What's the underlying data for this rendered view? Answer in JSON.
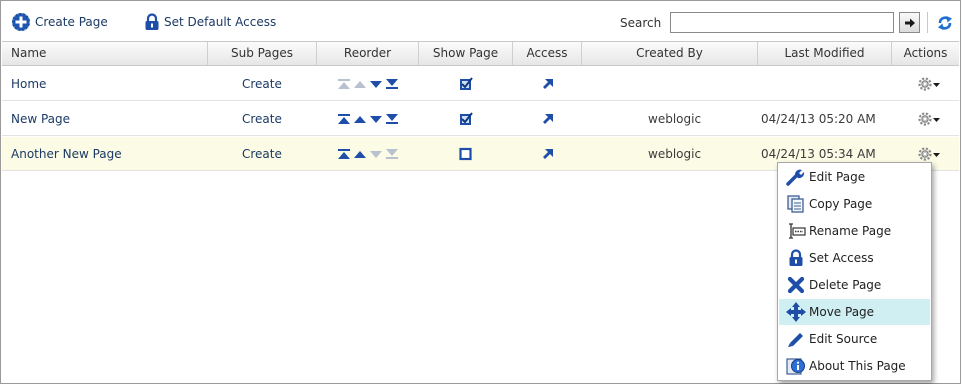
{
  "toolbar": {
    "create_page": "Create Page",
    "set_default_access": "Set Default Access",
    "search_label": "Search",
    "search_value": ""
  },
  "columns": [
    "Name",
    "Sub Pages",
    "Reorder",
    "Show Page",
    "Access",
    "Created By",
    "Last Modified",
    "Actions"
  ],
  "rows": [
    {
      "name": "Home",
      "sub_pages": "Create",
      "show_page": true,
      "created_by": "",
      "last_modified": "",
      "reorder_enabled": [
        false,
        false,
        true,
        true
      ]
    },
    {
      "name": "New Page",
      "sub_pages": "Create",
      "show_page": true,
      "created_by": "weblogic",
      "last_modified": "04/24/13 05:20 AM",
      "reorder_enabled": [
        true,
        true,
        true,
        true
      ]
    },
    {
      "name": "Another New Page",
      "sub_pages": "Create",
      "show_page": false,
      "created_by": "weblogic",
      "last_modified": "04/24/13 05:34 AM",
      "reorder_enabled": [
        true,
        true,
        false,
        false
      ]
    }
  ],
  "actions_menu": {
    "items": [
      "Edit Page",
      "Copy Page",
      "Rename Page",
      "Set Access",
      "Delete Page",
      "Move Page",
      "Edit Source",
      "About This Page"
    ],
    "highlighted": "Move Page"
  },
  "icons": {
    "create_page": "add-circle-icon",
    "set_default_access": "lock-icon",
    "search_go": "arrow-right-icon",
    "refresh": "refresh-icon",
    "access": "arrow-up-right-icon",
    "actions": "gear-dropdown-icon"
  },
  "colors": {
    "link": "#1c3a64",
    "accent_blue": "#1e4ea8",
    "arrow_disabled": "#b7c1d0",
    "selected_row": "#fbfbe6",
    "menu_highlight": "#cfeff3"
  }
}
